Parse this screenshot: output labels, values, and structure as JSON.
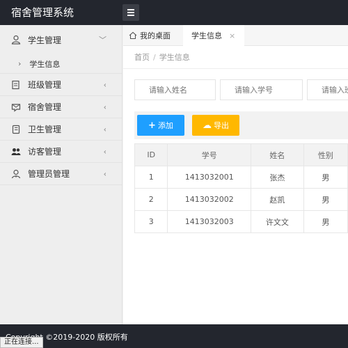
{
  "header": {
    "title": "宿舍管理系统",
    "menu_icon": "hamburger-icon"
  },
  "sidebar": {
    "items": [
      {
        "label": "学生管理",
        "icon": "user-icon",
        "arrow": "﹀"
      },
      {
        "label": "班级管理",
        "icon": "document-icon",
        "arrow": "‹"
      },
      {
        "label": "宿舍管理",
        "icon": "message-icon",
        "arrow": "‹"
      },
      {
        "label": "卫生管理",
        "icon": "notebook-icon",
        "arrow": "‹"
      },
      {
        "label": "访客管理",
        "icon": "users-icon",
        "arrow": "‹"
      },
      {
        "label": "管理员管理",
        "icon": "admin-icon",
        "arrow": "‹"
      }
    ],
    "sub_items": [
      {
        "label": "学生信息",
        "arrow": "›"
      }
    ]
  },
  "tabs": {
    "home_label": "我的桌面",
    "active_label": "学生信息",
    "close_glyph": "×"
  },
  "breadcrumb": {
    "home": "首页",
    "separator": "/",
    "current": "学生信息"
  },
  "search": {
    "name_placeholder": "请输入姓名",
    "number_placeholder": "请输入学号",
    "class_placeholder": "请输入班级"
  },
  "toolbar": {
    "add_label": "添加",
    "export_label": "导出",
    "add_icon": "+",
    "export_icon": "☁"
  },
  "table": {
    "headers": [
      "ID",
      "学号",
      "姓名",
      "性别"
    ],
    "rows": [
      [
        "1",
        "1413032001",
        "张杰",
        "男"
      ],
      [
        "2",
        "1413032002",
        "赵凯",
        "男"
      ],
      [
        "3",
        "1413032003",
        "许文文",
        "男"
      ]
    ]
  },
  "footer": {
    "copyright": "Copyright ©2019-2020 版权所有"
  },
  "status": {
    "text": "正在连接..."
  },
  "colors": {
    "header_bg": "#23262e",
    "add_button": "#1e9fff",
    "export_button": "#ffb800"
  }
}
